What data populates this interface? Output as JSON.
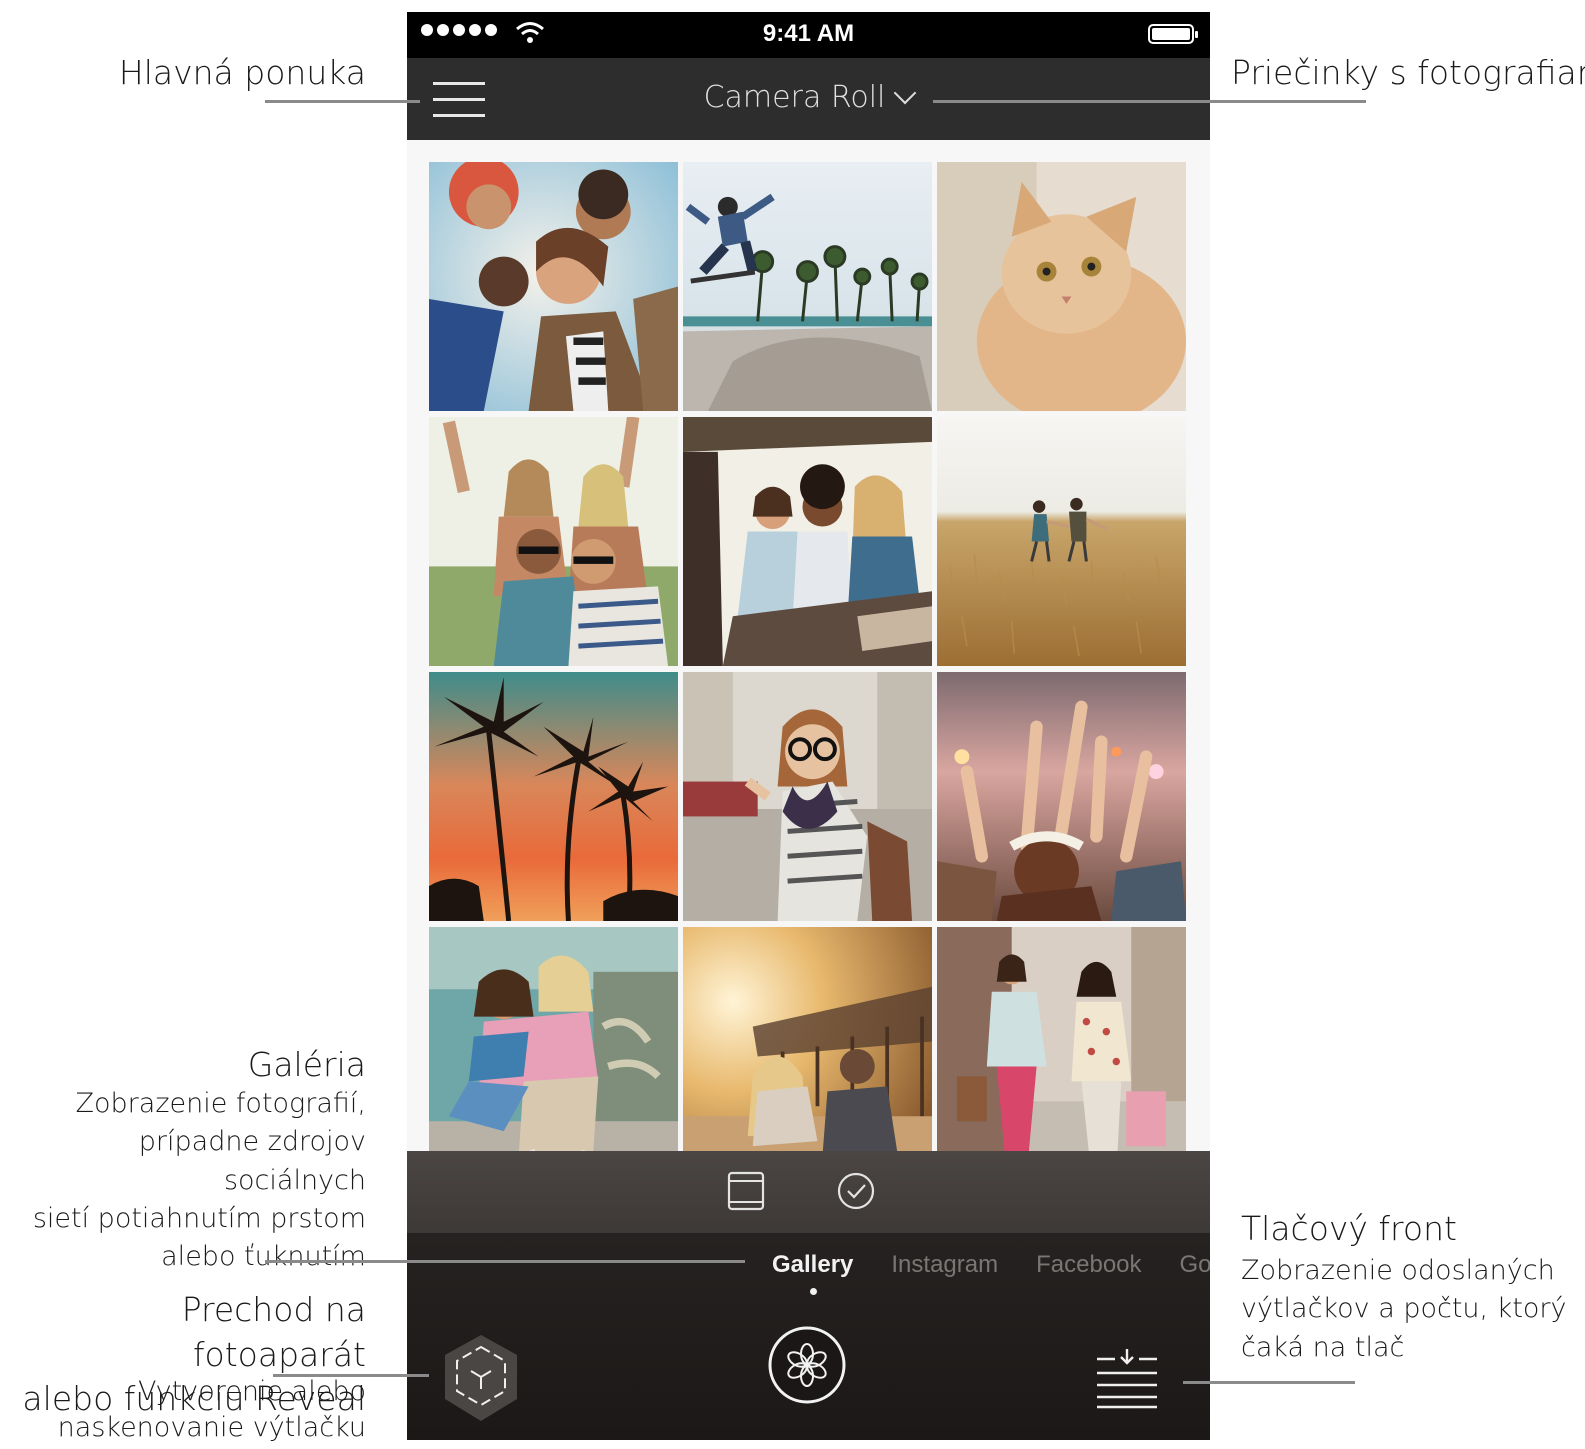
{
  "status_bar": {
    "time": "9:41 AM"
  },
  "header": {
    "folder_label": "Camera Roll"
  },
  "photos": [
    {
      "subject": "friends looking down"
    },
    {
      "subject": "skateboarder jump"
    },
    {
      "subject": "cat"
    },
    {
      "subject": "festival friends"
    },
    {
      "subject": "friends in car"
    },
    {
      "subject": "couple in field"
    },
    {
      "subject": "palm trees sunset"
    },
    {
      "subject": "girl with glasses"
    },
    {
      "subject": "concert crowd"
    },
    {
      "subject": "piggyback girls"
    },
    {
      "subject": "couple on pier beach"
    },
    {
      "subject": "shopping girls"
    }
  ],
  "source_tabs": [
    "Gallery",
    "Instagram",
    "Facebook",
    "Google"
  ],
  "annotations": {
    "menu": {
      "title": "Hlavná ponuka"
    },
    "folders": {
      "title": "Priečinky s fotografiami"
    },
    "gallery": {
      "title": "Galéria",
      "desc": [
        "Zobrazenie fotografií,",
        "prípadne zdrojov sociálnych",
        "sietí potiahnutím prstom",
        "alebo ťuknutím"
      ]
    },
    "camera": {
      "title": [
        "Prechod na fotoaparát",
        "alebo funkciu Reveal"
      ],
      "desc": [
        "Vytvorenie alebo",
        "naskenovanie výtlačku"
      ]
    },
    "queue": {
      "title": "Tlačový front",
      "desc": [
        "Zobrazenie odoslaných",
        "výtlačkov a počtu, ktorý",
        "čaká na tlač"
      ]
    }
  },
  "colors": {
    "navbar": "#2d2d2d",
    "status_bar": "#000000",
    "leader": "#8a8a8a"
  }
}
